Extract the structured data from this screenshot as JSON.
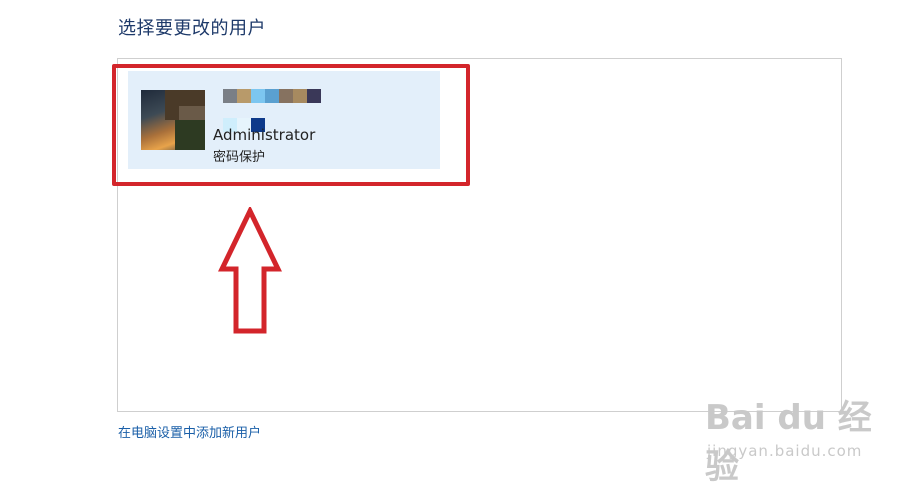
{
  "page": {
    "heading": "选择要更改的用户",
    "add_user_link": "在电脑设置中添加新用户"
  },
  "account": {
    "name": "Administrator",
    "status": "密码保护"
  },
  "watermark": {
    "logo": "Bai du 经验",
    "url": "jingyan.baidu.com"
  },
  "colors": {
    "heading": "#1e3a6a",
    "link": "#1a5fa8",
    "tile_bg": "#e3effa",
    "highlight": "#d3252b"
  }
}
